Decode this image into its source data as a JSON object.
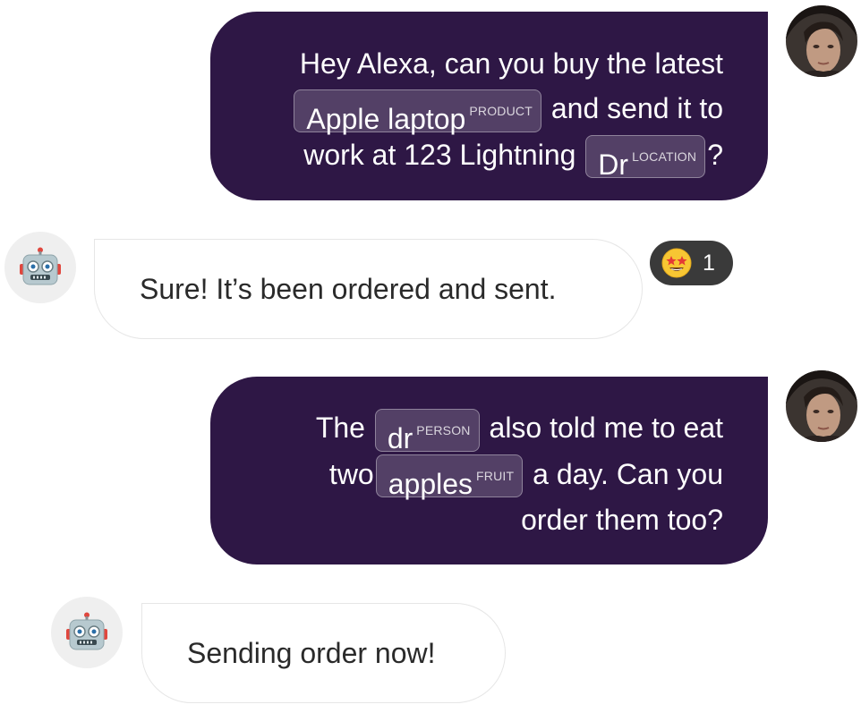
{
  "messages": {
    "m1": {
      "sender": "user",
      "line1": {
        "text": "Hey Alexa, can you buy the latest"
      },
      "line2": {
        "entity": {
          "text": "Apple laptop",
          "label": "PRODUCT"
        },
        "after": "and send it to"
      },
      "line3": {
        "before": "work at 123 Lightning",
        "entity": {
          "text": "Dr",
          "label": "LOCATION"
        },
        "after": "?"
      }
    },
    "m2": {
      "sender": "bot",
      "text": "Sure! It’s been ordered and sent.",
      "reaction": {
        "icon": "star-struck-emoji-icon",
        "count": "1"
      }
    },
    "m3": {
      "sender": "user",
      "line1": {
        "before": "The",
        "entity": {
          "text": "dr",
          "label": "PERSON"
        },
        "after": "also told me to eat"
      },
      "line2": {
        "before": "two",
        "entity": {
          "text": "apples",
          "label": "FRUIT"
        },
        "after": "a day. Can you"
      },
      "line3": {
        "text": "order them too?"
      }
    },
    "m4": {
      "sender": "bot",
      "text": "Sending order now!"
    }
  },
  "colors": {
    "user_bubble": "#2e1745",
    "bot_bubble_border": "#e6e6e6",
    "reaction_pill": "#3a3a3a"
  },
  "icons": {
    "user_avatar": "user-avatar-photo",
    "bot_avatar": "robot-face-icon"
  }
}
